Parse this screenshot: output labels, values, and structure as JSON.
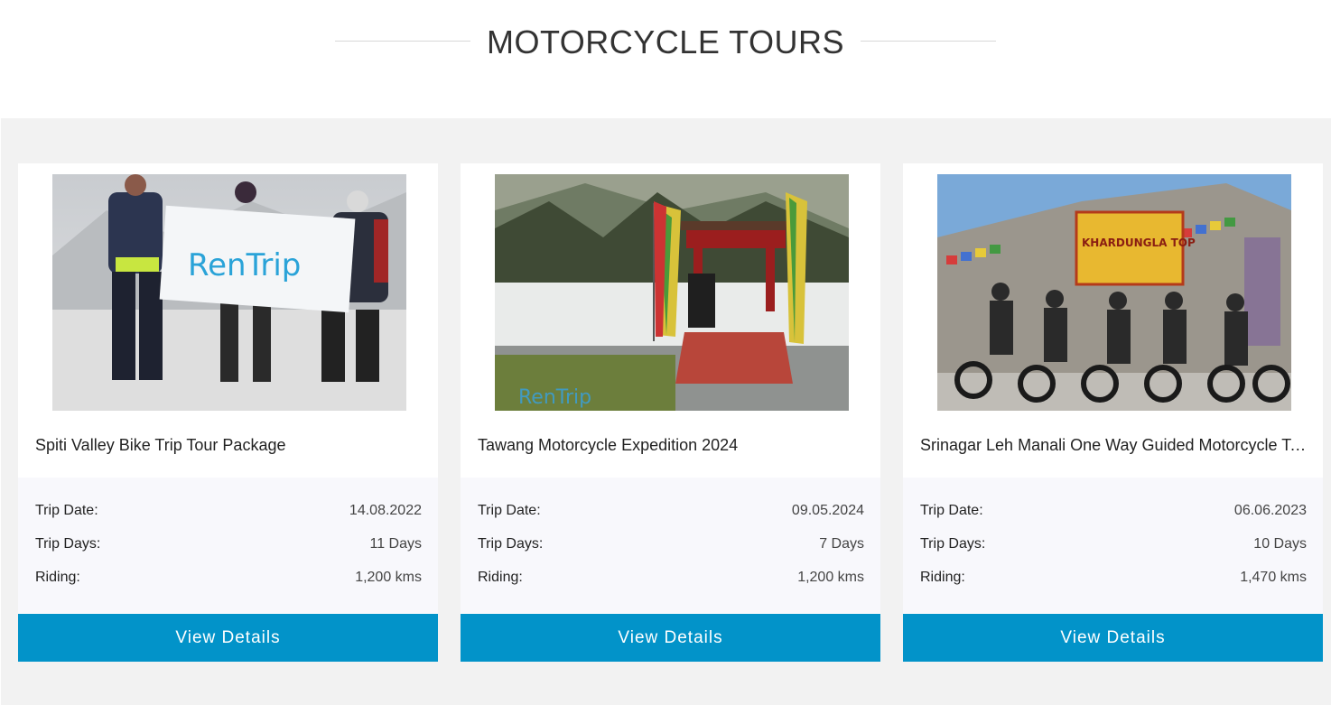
{
  "section": {
    "title": "MOTORCYCLE TOURS"
  },
  "cards": [
    {
      "title": "Spiti Valley Bike Trip Tour Package",
      "trip_date_label": "Trip Date:",
      "trip_date": "14.08.2022",
      "trip_days_label": "Trip Days:",
      "trip_days": "11 Days",
      "riding_label": "Riding:",
      "riding": "1,200 kms",
      "button": "View Details",
      "banner_text": "RenTrip"
    },
    {
      "title": "Tawang Motorcycle Expedition 2024",
      "trip_date_label": "Trip Date:",
      "trip_date": "09.05.2024",
      "trip_days_label": "Trip Days:",
      "trip_days": "7 Days",
      "riding_label": "Riding:",
      "riding": "1,200 kms",
      "button": "View Details",
      "watermark": "RenTrip"
    },
    {
      "title": "Srinagar Leh Manali One Way Guided Motorcycle Tour",
      "trip_date_label": "Trip Date:",
      "trip_date": "06.06.2023",
      "trip_days_label": "Trip Days:",
      "trip_days": "10 Days",
      "riding_label": "Riding:",
      "riding": "1,470 kms",
      "button": "View Details",
      "sign_text": "KHARDUNGLA TOP"
    }
  ],
  "colors": {
    "accent": "#0293c9",
    "panel_bg": "#f2f2f2"
  }
}
